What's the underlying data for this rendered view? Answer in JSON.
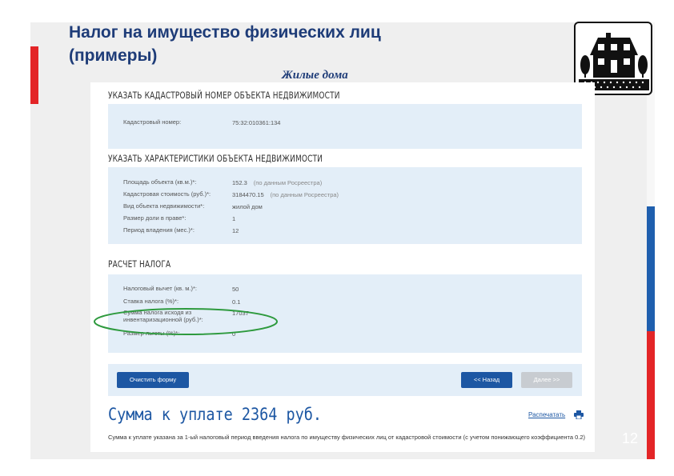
{
  "slide": {
    "title_line1": "Налог на имущество физических лиц",
    "title_line2": "(примеры)",
    "subtitle": "Жилые дома",
    "page_number": "12"
  },
  "colors": {
    "accent_red": "#e32527",
    "brand_blue": "#1d57a3",
    "title_blue": "#1e3c78",
    "panel_bg": "#e3eef8",
    "highlight_green": "#2e9a3e"
  },
  "form": {
    "section1_title": "УКАЗАТЬ КАДАСТРОВЫЙ НОМЕР ОБЪЕКТА НЕДВИЖИМОСТИ",
    "cadastral": {
      "label": "Кадастровый номер:",
      "value": "75:32:010361:134"
    },
    "section2_title": "УКАЗАТЬ ХАРАКТЕРИСТИКИ ОБЪЕКТА НЕДВИЖИМОСТИ",
    "characteristics": [
      {
        "label": "Площадь объекта (кв.м.)*:",
        "value": "152.3",
        "note": "(по данным Росреестра)"
      },
      {
        "label": "Кадастровая стоимость (руб.)*:",
        "value": "3184470.15",
        "note": "(по данным Росреестра)"
      },
      {
        "label": "Вид объекта недвижимости*:",
        "value": "жилой дом",
        "note": ""
      },
      {
        "label": "Размер доли в праве*:",
        "value": "1",
        "note": ""
      },
      {
        "label": "Период владения (мес.)*:",
        "value": "12",
        "note": ""
      }
    ],
    "section3_title": "РАСЧЕТ НАЛОГА",
    "calculation": [
      {
        "label": "Налоговый вычет (кв. м.)*:",
        "value": "50"
      },
      {
        "label": "Ставка налога (%)*:",
        "value": "0.1"
      },
      {
        "label": "Сумма налога исходя из инвентаризационной (руб.)*:",
        "value": "17037"
      },
      {
        "label": "Размер льготы (%)*:",
        "value": "0"
      }
    ],
    "buttons": {
      "clear": "Очистить форму",
      "back": "<< Назад",
      "next": "Далее >>"
    },
    "result": {
      "total": "Сумма к уплате 2364 руб.",
      "print_label": "Распечатать",
      "footnote": "Сумма к уплате указана за 1-ый налоговый период введения налога по имуществу физических лиц от кадастровой стоимости (с учетом понижающего коэффициента 0.2)"
    }
  },
  "icons": {
    "house": "house-icon",
    "print": "printer-icon"
  }
}
